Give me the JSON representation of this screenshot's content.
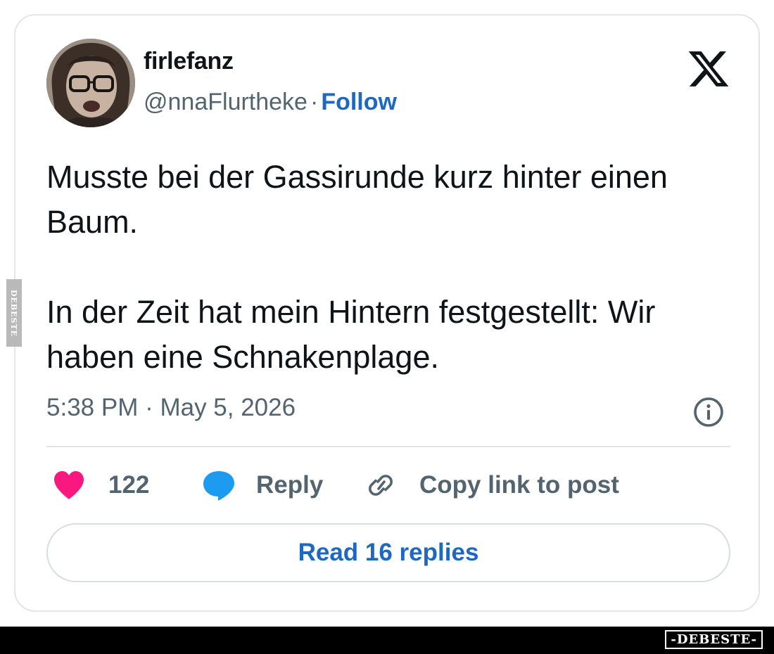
{
  "user": {
    "display_name": "firlefanz",
    "handle": "@nnaFlurtheke",
    "separator": "·",
    "follow_label": "Follow"
  },
  "tweet": {
    "paragraphs": [
      "Musste bei der Gassirunde kurz hinter einen Baum.",
      "In der Zeit hat mein Hintern festgestellt: Wir haben eine Schnakenplage."
    ],
    "timestamp": "5:38 PM · May 5, 2026"
  },
  "actions": {
    "like_count": "122",
    "reply_label": "Reply",
    "copy_label": "Copy link to post"
  },
  "read_replies_label": "Read 16 replies",
  "watermarks": {
    "side": "DEBESTE",
    "brand": "-DEBESTE-"
  },
  "icons": {
    "logo": "x-logo-icon",
    "info": "info-icon",
    "like": "heart-icon",
    "reply": "speech-bubble-icon",
    "copy": "link-icon"
  },
  "colors": {
    "text": "#0f1419",
    "secondary": "#536471",
    "link": "#1d68c3",
    "heart": "#f91880",
    "reply_bubble": "#1d9bf0",
    "border": "#e3e6e8"
  }
}
